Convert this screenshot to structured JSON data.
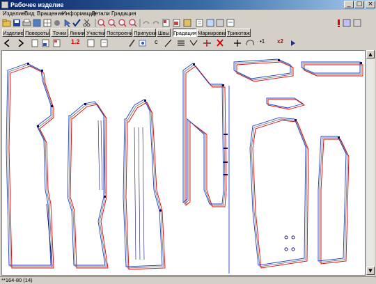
{
  "window": {
    "title": "Рабочее изделие",
    "controls": {
      "minimize": "_",
      "maximize": "□",
      "close": "×"
    }
  },
  "menu": [
    "Изделие",
    "Вид",
    "Вращение",
    "Информация",
    "Детали",
    "Градация"
  ],
  "tabs": [
    {
      "label": "Изделие"
    },
    {
      "label": "Повороты"
    },
    {
      "label": "Точки"
    },
    {
      "label": "Линии"
    },
    {
      "label": "Участки"
    },
    {
      "label": "Построения"
    },
    {
      "label": "Припуски"
    },
    {
      "label": "Швы"
    },
    {
      "label": "Градация",
      "active": true
    },
    {
      "label": "Маркировка"
    },
    {
      "label": "Трикотаж"
    }
  ],
  "toolbar1_icons": [
    "open-folder-icon",
    "save-icon",
    "print-icon",
    "settings-icon",
    "grid-icon",
    "circle-icon",
    "select-arrow-icon",
    "check-icon",
    "scissors-icon",
    "zoom-in-icon",
    "zoom-out-icon",
    "zoom-fit-icon",
    "zoom-window-icon",
    "undo-icon",
    "redo-icon",
    "new-piece-icon",
    "copy-piece-icon",
    "paste-piece-icon",
    "measure-icon",
    "table-icon",
    "info-icon",
    "notes-icon",
    "warning-icon",
    "compare-icon"
  ],
  "toolbar2": {
    "labels": {
      "step_1_2": "1.2",
      "point_c": "c",
      "count_1": "•1",
      "scale_x2": "x2"
    },
    "icons": [
      "back-arrow-icon",
      "forward-arrow-icon",
      "new-file-icon",
      "open-icon",
      "save-icon",
      "document-icon",
      "doc-small-icon",
      "pencil-icon",
      "grade-point-icon",
      "line-tool-icon",
      "curve-tool-icon",
      "parallel-icon",
      "move-point-icon",
      "delete-red-icon",
      "plus-icon",
      "rotate-icon",
      "play-icon"
    ]
  },
  "colors": {
    "accent_red": "#e00000",
    "accent_blue": "#1a3fd0",
    "pattern_dark": "#0a0a6a",
    "grade_gray": "#7a7a7a"
  },
  "status": {
    "size_label": "**164-80 (14)"
  }
}
